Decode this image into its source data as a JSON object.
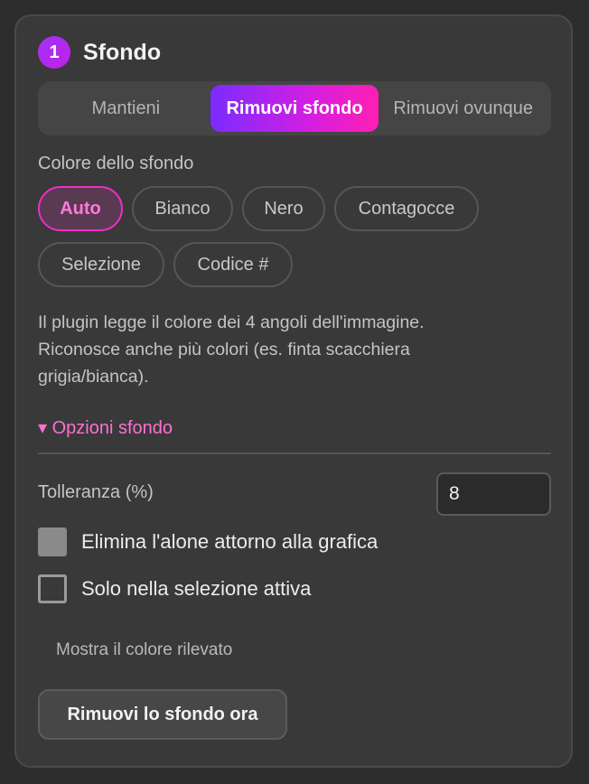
{
  "section": {
    "step_number": "1",
    "title": "Sfondo"
  },
  "mode_tabs": {
    "items": [
      {
        "label": "Mantieni",
        "active": false
      },
      {
        "label": "Rimuovi sfondo",
        "active": true
      },
      {
        "label": "Rimuovi ovunque",
        "active": false
      }
    ]
  },
  "bg_color": {
    "label": "Colore dello sfondo",
    "chips": [
      {
        "label": "Auto",
        "active": true
      },
      {
        "label": "Bianco",
        "active": false
      },
      {
        "label": "Nero",
        "active": false
      },
      {
        "label": "Contagocce",
        "active": false
      },
      {
        "label": "Selezione",
        "active": false
      },
      {
        "label": "Codice #",
        "active": false
      }
    ]
  },
  "description": "Il plugin legge il colore dei 4 angoli dell'immagine. Riconosce anche più colori (es. finta scacchiera grigia/bianca).",
  "options": {
    "toggle_label": "▾ Opzioni sfondo",
    "tolerance_label": "Tolleranza (%)",
    "tolerance_value": "8",
    "checkbox_halo": {
      "label": "Elimina l'alone attorno alla grafica",
      "checked": true
    },
    "checkbox_selection": {
      "label": "Solo nella selezione attiva",
      "checked": false
    }
  },
  "show_detected_label": "Mostra il colore rilevato",
  "action_button_label": "Rimuovi lo sfondo ora",
  "colors": {
    "accent_pink": "#ff6fd2",
    "accent_purple": "#a233f5",
    "panel_bg": "#393939"
  }
}
